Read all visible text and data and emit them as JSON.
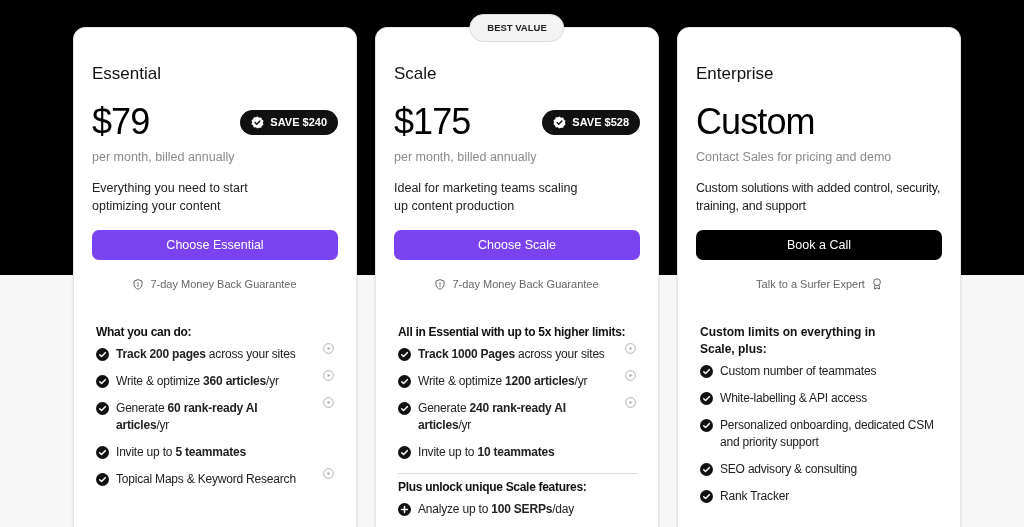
{
  "plans": [
    {
      "name": "Essential",
      "price": "$79",
      "save": "SAVE $240",
      "price_note": "per month, billed annually",
      "description": "Everything you need to start optimizing your content",
      "button": "Choose Essential",
      "note": "7-day Money Back Guarantee",
      "sections": [
        {
          "heading": "What you can do:",
          "items": [
            {
              "text": "**Track 200 pages** across your sites",
              "kind": "check",
              "video": true
            },
            {
              "text": "Write & optimize **360 articles**/yr",
              "kind": "check",
              "video": true
            },
            {
              "text": "Generate **60 rank-ready AI articles**/yr",
              "kind": "check",
              "video": true
            },
            {
              "text": "Invite up to **5 teammates**",
              "kind": "check",
              "video": false
            },
            {
              "text": "Topical Maps & Keyword Research",
              "kind": "check",
              "video": true
            }
          ]
        }
      ]
    },
    {
      "name": "Scale",
      "badge": "BEST VALUE",
      "price": "$175",
      "save": "SAVE $528",
      "price_note": "per month, billed annually",
      "description": "Ideal for marketing teams scaling up content production",
      "button": "Choose Scale",
      "note": "7-day Money Back Guarantee",
      "sections": [
        {
          "heading": "All in Essential with up to 5x higher limits:",
          "items": [
            {
              "text": "**Track 1000 Pages** across your sites",
              "kind": "check",
              "video": true
            },
            {
              "text": "Write & optimize **1200 articles**/yr",
              "kind": "check",
              "video": true
            },
            {
              "text": "Generate **240 rank-ready AI articles**/yr",
              "kind": "check",
              "video": true
            },
            {
              "text": "Invite up to **10 teammates**",
              "kind": "check",
              "video": false
            }
          ]
        },
        {
          "heading": "Plus unlock unique Scale features:",
          "items": [
            {
              "text": "Analyze up to **100 SERPs**/day",
              "kind": "plus",
              "video": false
            }
          ]
        }
      ]
    },
    {
      "name": "Enterprise",
      "price": "Custom",
      "price_note": "Contact Sales for pricing and demo",
      "description": "Custom solutions with added control, security, training, and support",
      "button": "Book a Call",
      "note": "Talk to a Surfer Expert",
      "sections": [
        {
          "heading": "Custom limits on everything in Scale, plus:",
          "items": [
            {
              "text": "Custom number of teammates",
              "kind": "check",
              "video": false
            },
            {
              "text": "White-labelling & API access",
              "kind": "check",
              "video": false
            },
            {
              "text": "Personalized onboarding, dedicated CSM and priority support",
              "kind": "check",
              "video": false
            },
            {
              "text": "SEO advisory & consulting",
              "kind": "check",
              "video": false
            },
            {
              "text": "Rank Tracker",
              "kind": "check",
              "video": false
            }
          ]
        }
      ]
    }
  ]
}
